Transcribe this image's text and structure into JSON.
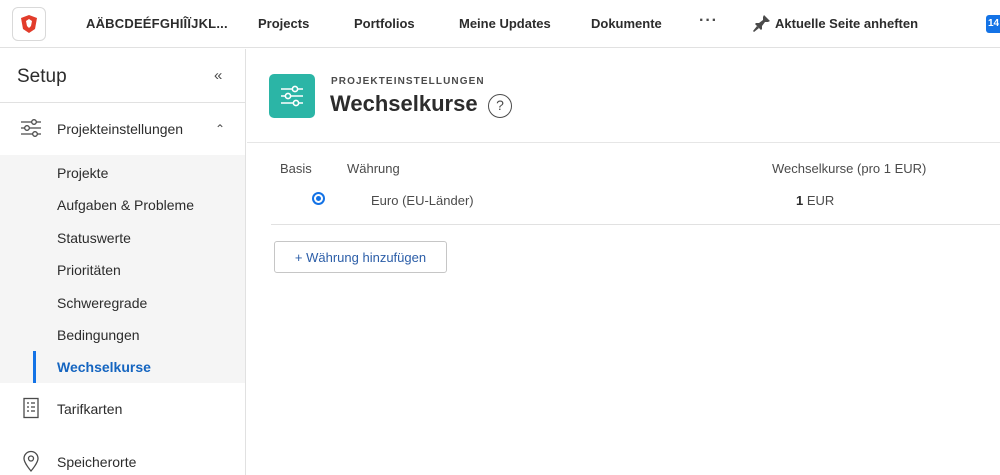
{
  "topbar": {
    "org_name": "AÄBCDEÉFGHIÎÏJKL...",
    "nav": [
      "Projects",
      "Portfolios",
      "Meine Updates",
      "Dokumente"
    ],
    "more": "···",
    "pin_label": "Aktuelle Seite anheften",
    "badge": "14"
  },
  "sidebar": {
    "title": "Setup",
    "collapse": "«",
    "section_expanded": "Projekteinstellungen",
    "subitems": [
      "Projekte",
      "Aufgaben & Probleme",
      "Statuswerte",
      "Prioritäten",
      "Schweregrade",
      "Bedingungen",
      "Wechselkurse"
    ],
    "active_subitem": "Wechselkurse",
    "sections": [
      "Tarifkarten",
      "Speicherorte"
    ]
  },
  "main": {
    "eyebrow": "PROJEKTEINSTELLUNGEN",
    "title": "Wechselkurse",
    "help": "?",
    "table": {
      "headers": [
        "Basis",
        "Währung",
        "Wechselkurse (pro 1 EUR)"
      ],
      "rows": [
        {
          "base": true,
          "currency": "Euro (EU-Länder)",
          "rate": "1",
          "unit": "EUR"
        }
      ]
    },
    "add_button": "+ Währung hinzufügen"
  },
  "colors": {
    "accent": "#1473e6",
    "header_icon_bg": "#2bb5a6",
    "logo_red": "#e23c2b"
  }
}
